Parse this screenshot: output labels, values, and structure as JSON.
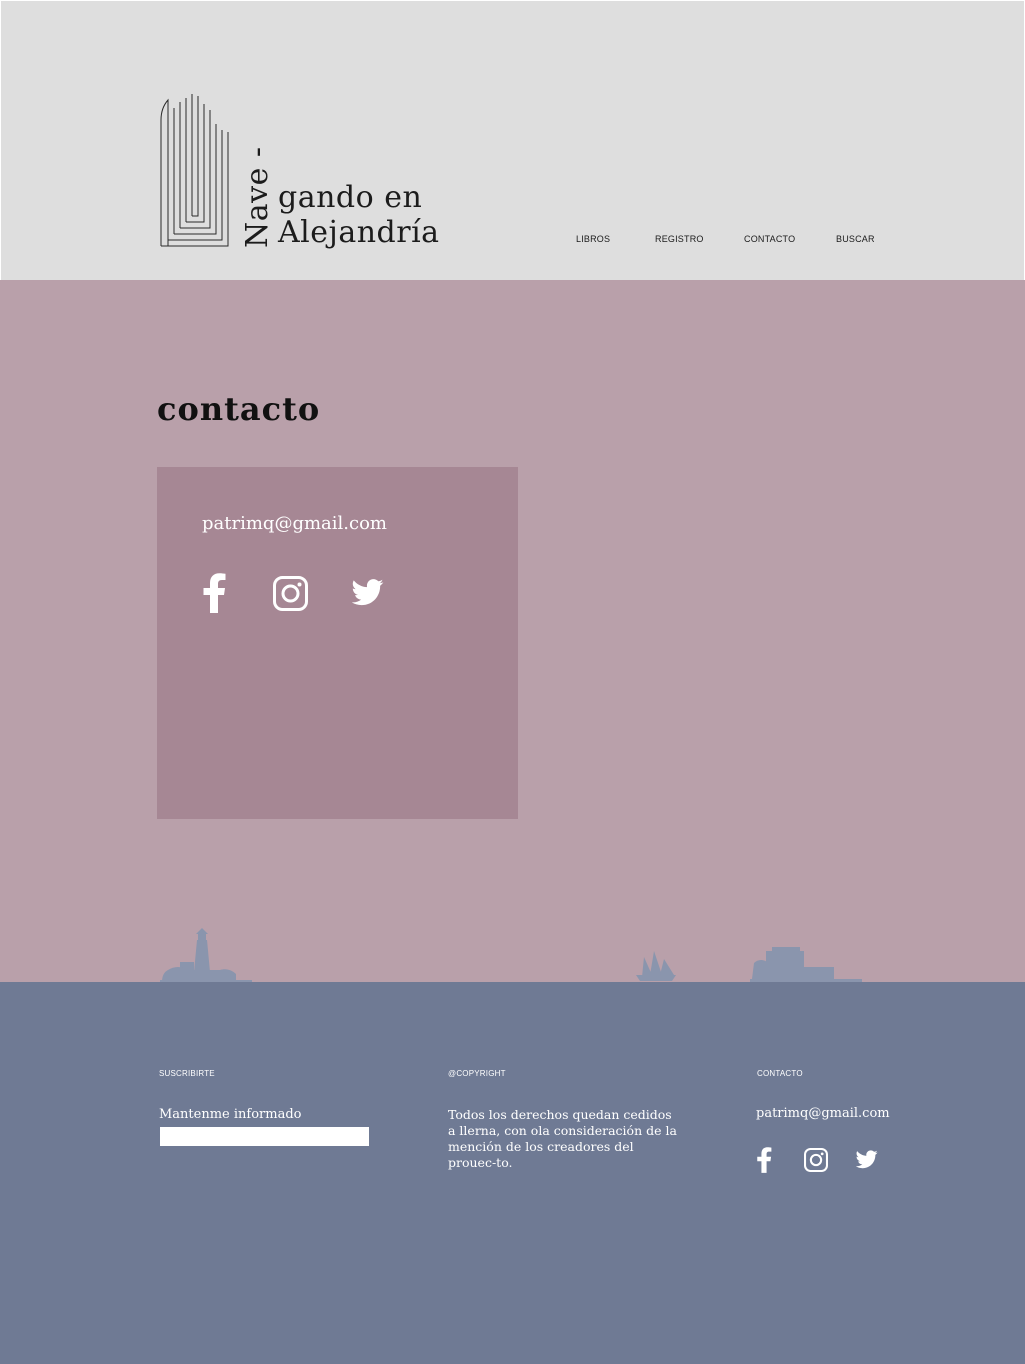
{
  "header": {
    "brand_vertical": "Nave -",
    "brand_line1": "gando en",
    "brand_line2": "Alejandría",
    "nav": [
      "LIBROS",
      "REGISTRO",
      "CONTACTO",
      "BUSCAR"
    ]
  },
  "main": {
    "title": "contacto",
    "email": "patrimq@gmail.com",
    "social_icons": [
      "facebook-icon",
      "instagram-icon",
      "twitter-icon"
    ]
  },
  "footer": {
    "subscribe_heading": "SUSCRIBIRTE",
    "subscribe_label": "Mantenme informado",
    "subscribe_input_value": "",
    "copyright_heading": "@COPYRIGHT",
    "copyright_text": "Todos los derechos quedan cedidos a llerna, con ola consideración de la mención de los creadores del prouec-to.",
    "contact_heading": "CONTACTO",
    "contact_email": "patrimq@gmail.com"
  },
  "colors": {
    "header_bg": "#dedede",
    "main_bg": "#b9a0aa",
    "card_bg": "#a68794",
    "footer_bg": "#6f7a94",
    "silhouette": "#8a95ad"
  }
}
